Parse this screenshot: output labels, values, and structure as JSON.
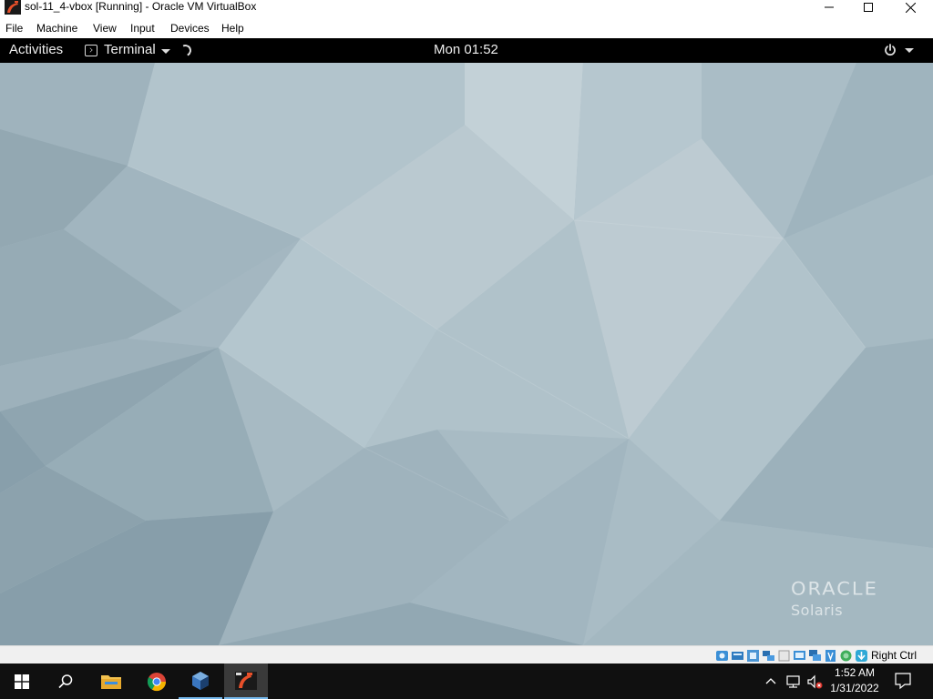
{
  "window": {
    "title": "sol-11_4-vbox [Running] - Oracle VM VirtualBox",
    "controls": [
      "minimize",
      "maximize",
      "close"
    ]
  },
  "menubar": {
    "items": [
      {
        "label": "File"
      },
      {
        "label": "Machine"
      },
      {
        "label": "View"
      },
      {
        "label": "Input"
      },
      {
        "label": "Devices"
      },
      {
        "label": "Help"
      }
    ]
  },
  "guest": {
    "panel": {
      "activities": "Activities",
      "app_name": "Terminal",
      "clock": "Mon 01:52"
    },
    "branding": {
      "vendor": "ORACLE",
      "product": "Solaris"
    },
    "colors": {
      "wallpaper_base": "#a7bac3",
      "panel_bg": "#000000"
    }
  },
  "statusbar": {
    "icons": [
      "hard-disk-icon",
      "optical-drive-icon",
      "audio-icon",
      "network-icon",
      "usb-icon",
      "shared-folders-icon",
      "display-icon",
      "video-capture-icon",
      "cpu-icon",
      "mouse-integration-icon",
      "keyboard-icon"
    ],
    "host_key": "Right Ctrl"
  },
  "taskbar": {
    "apps": [
      {
        "icon": "start-icon"
      },
      {
        "icon": "search-icon"
      },
      {
        "icon": "file-explorer-icon"
      },
      {
        "icon": "chrome-icon"
      },
      {
        "icon": "virtualbox-icon"
      },
      {
        "icon": "vm-window-icon"
      }
    ],
    "tray": {
      "time": "1:52 AM",
      "date": "1/31/2022"
    },
    "colors": {
      "bg": "#101010",
      "accent": "#76b9ed"
    }
  }
}
